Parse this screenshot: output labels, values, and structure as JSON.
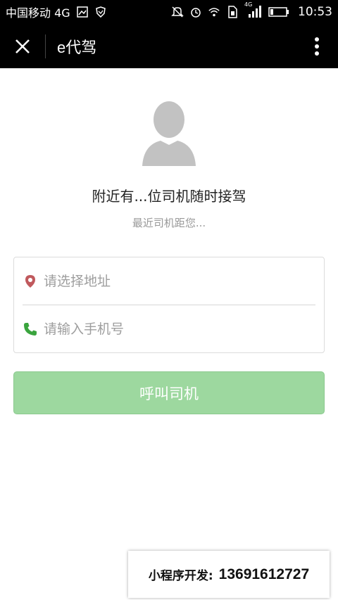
{
  "status_bar": {
    "carrier": "中国移动 4G",
    "network_label": "4G",
    "time": "10:53"
  },
  "nav": {
    "title": "e代驾"
  },
  "main": {
    "headline": "附近有...位司机随时接驾",
    "subline": "最近司机距您..."
  },
  "form": {
    "address_placeholder": "请选择地址",
    "phone_placeholder": "请输入手机号"
  },
  "call_button": {
    "label": "呼叫司机"
  },
  "promo": {
    "label": "小程序开发:",
    "phone": "13691612727"
  },
  "colors": {
    "button_bg": "#9dd89f",
    "location_icon": "#c0595d",
    "phone_icon": "#3aa43e"
  }
}
